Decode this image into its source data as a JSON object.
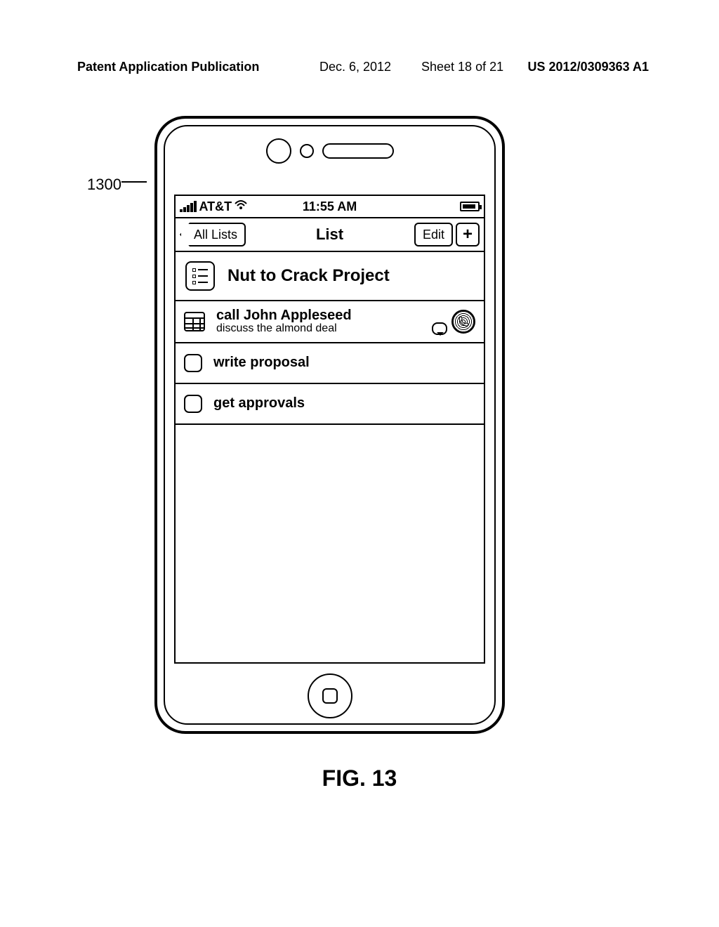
{
  "page_header": {
    "publication": "Patent Application Publication",
    "date": "Dec. 6, 2012",
    "sheet": "Sheet 18 of 21",
    "pubno": "US 2012/0309363 A1"
  },
  "reference": {
    "label": "1300"
  },
  "status_bar": {
    "carrier": "AT&T",
    "time": "11:55 AM"
  },
  "nav": {
    "back": "All Lists",
    "title": "List",
    "edit": "Edit",
    "add": "+"
  },
  "list": {
    "title": "Nut to Crack Project"
  },
  "tasks": [
    {
      "title": "call John Appleseed",
      "subtitle": "discuss the almond deal",
      "has_date": true,
      "has_sms": true,
      "has_call": true
    },
    {
      "title": "write proposal",
      "subtitle": "",
      "has_date": false,
      "has_sms": false,
      "has_call": false
    },
    {
      "title": "get approvals",
      "subtitle": "",
      "has_date": false,
      "has_sms": false,
      "has_call": false
    }
  ],
  "figure_label": "FIG. 13"
}
